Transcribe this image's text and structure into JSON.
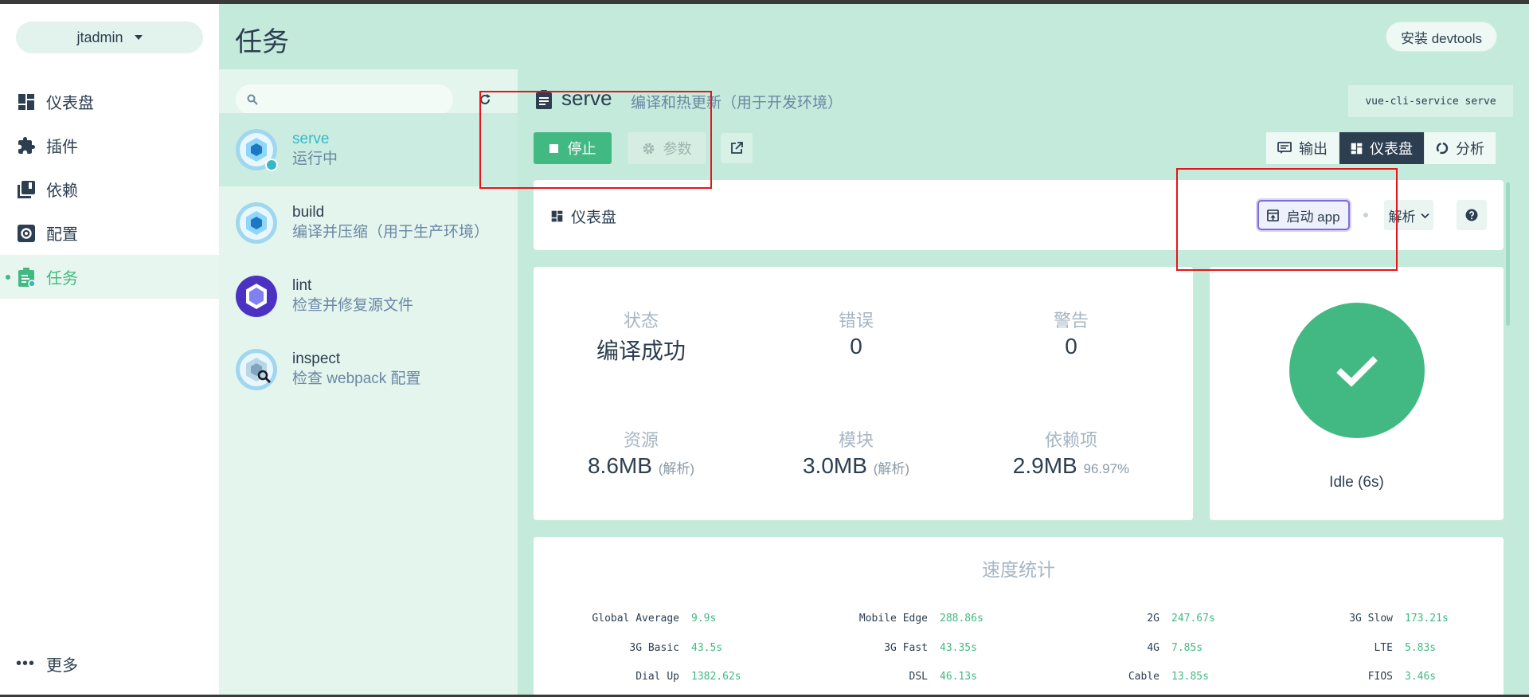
{
  "sidebar": {
    "project": "jtadmin",
    "items": [
      {
        "label": "仪表盘",
        "icon": "dashboard-icon"
      },
      {
        "label": "插件",
        "icon": "puzzle-icon"
      },
      {
        "label": "依赖",
        "icon": "library-icon"
      },
      {
        "label": "配置",
        "icon": "settings-icon"
      },
      {
        "label": "任务",
        "icon": "clipboard-icon"
      }
    ],
    "more": "更多"
  },
  "header": {
    "title": "任务",
    "devtools": "安装 devtools"
  },
  "tasks": {
    "search_placeholder": "",
    "items": [
      {
        "name": "serve",
        "desc": "运行中"
      },
      {
        "name": "build",
        "desc": "编译并压缩（用于生产环境）"
      },
      {
        "name": "lint",
        "desc": "检查并修复源文件"
      },
      {
        "name": "inspect",
        "desc": "检查 webpack 配置"
      }
    ]
  },
  "main": {
    "title": "serve",
    "subtitle": "编译和热更新（用于开发环境）",
    "command": "vue-cli-service serve",
    "stop": "停止",
    "params": "参数",
    "tabs": [
      "输出",
      "仪表盘",
      "分析"
    ],
    "dashboard_label": "仪表盘",
    "launch": "启动 app",
    "analyze": "解析"
  },
  "stats": {
    "status": {
      "label": "状态",
      "value": "编译成功"
    },
    "errors": {
      "label": "错误",
      "value": "0"
    },
    "warnings": {
      "label": "警告",
      "value": "0"
    },
    "assets": {
      "label": "资源",
      "value": "8.6MB",
      "note": "(解析)"
    },
    "modules": {
      "label": "模块",
      "value": "3.0MB",
      "note": "(解析)"
    },
    "deps": {
      "label": "依赖项",
      "value": "2.9MB",
      "note": "96.97%"
    }
  },
  "status_card": {
    "idle": "Idle (6s)"
  },
  "speed": {
    "title": "速度统计",
    "rows": [
      [
        [
          "Global Average",
          "9.9s"
        ],
        [
          "Mobile Edge",
          "288.86s"
        ],
        [
          "2G",
          "247.67s"
        ],
        [
          "3G Slow",
          "173.21s"
        ]
      ],
      [
        [
          "3G Basic",
          "43.5s"
        ],
        [
          "3G Fast",
          "43.35s"
        ],
        [
          "4G",
          "7.85s"
        ],
        [
          "LTE",
          "5.83s"
        ]
      ],
      [
        [
          "Dial Up",
          "1382.62s"
        ],
        [
          "DSL",
          "46.13s"
        ],
        [
          "Cable",
          "13.85s"
        ],
        [
          "FIOS",
          "3.46s"
        ]
      ]
    ]
  },
  "colors": {
    "accent": "#42b983",
    "dark": "#2c3e50",
    "annotation": "#e8141b"
  }
}
